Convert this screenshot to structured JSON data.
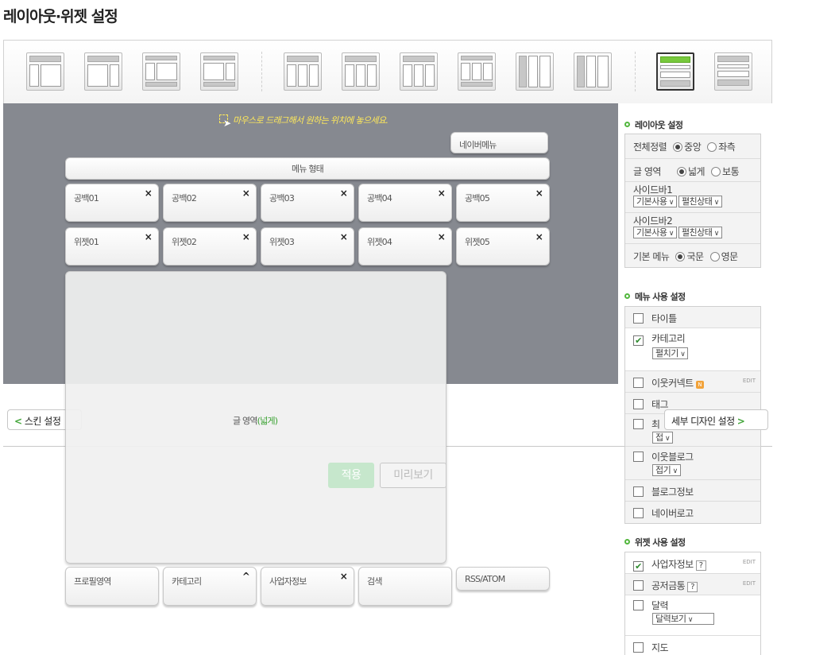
{
  "page_title": "레이아웃·위젯 설정",
  "canvas": {
    "hint": "마우스로 드래그해서 원하는 위치에 놓으세요.",
    "naver_menu": "네이버메뉴",
    "menu_bar": "메뉴 형태",
    "blank_row": [
      "공백01",
      "공백02",
      "공백03",
      "공백04",
      "공백05"
    ],
    "widget_row": [
      "위젯01",
      "위젯02",
      "위젯03",
      "위젯04",
      "위젯05"
    ],
    "main_area_label": "글 영역",
    "main_area_mode": "(넓게)",
    "bottom_widgets": [
      "프로필영역",
      "카테고리",
      "사업자정보",
      "검색",
      "RSS/ATOM"
    ],
    "close_symbol": "×",
    "up_symbol": "^"
  },
  "nav": {
    "back_label": "스킨 설정",
    "forward_label": "세부 디자인 설정",
    "apply_label": "적용",
    "preview_label": "미리보기"
  },
  "layout_settings": {
    "heading": "레이아웃 설정",
    "align_label": "전체정렬",
    "align_opt1": "중앙",
    "align_opt2": "좌측",
    "area_label": "글 영역",
    "area_opt1": "넓게",
    "area_opt2": "보통",
    "sidebar1_label": "사이드바1",
    "sidebar1_sel1": "기본사용",
    "sidebar1_sel2": "펼친상태",
    "sidebar2_label": "사이드바2",
    "sidebar2_sel1": "기본사용",
    "sidebar2_sel2": "펼친상태",
    "menu_label": "기본 메뉴",
    "menu_opt1": "국문",
    "menu_opt2": "영문"
  },
  "menu_settings": {
    "heading": "메뉴 사용 설정",
    "items": [
      "타이틀",
      "카테고리",
      "이웃커넥트",
      "태그",
      "최",
      "이웃블로그",
      "블로그정보",
      "네이버로고"
    ],
    "category_select": "펼치기",
    "recent_select": "접",
    "neighbor_select": "접기",
    "badge": "N",
    "edit": "EDIT"
  },
  "widget_settings": {
    "heading": "위젯 사용 설정",
    "items": [
      "사업자정보",
      "공저금통",
      "달력",
      "지도"
    ],
    "calendar_select": "달력보기",
    "help": "?",
    "edit": "EDIT"
  },
  "check_mark": "✔"
}
